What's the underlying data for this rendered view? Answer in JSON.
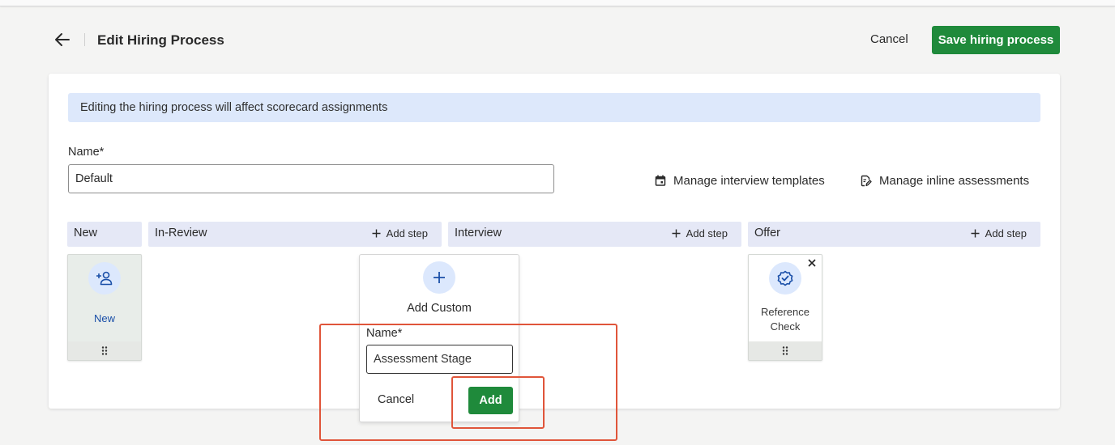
{
  "header": {
    "title": "Edit Hiring Process",
    "cancel_label": "Cancel",
    "save_label": "Save hiring process"
  },
  "banner": {
    "text": "Editing the hiring process will affect scorecard assignments"
  },
  "form": {
    "name_label": "Name*",
    "name_value": "Default"
  },
  "links": {
    "templates": "Manage interview templates",
    "assessments": "Manage inline assessments"
  },
  "columns": [
    {
      "label": "New"
    },
    {
      "label": "In-Review",
      "add_step": "Add step"
    },
    {
      "label": "Interview",
      "add_step": "Add step"
    },
    {
      "label": "Offer",
      "add_step": "Add step"
    }
  ],
  "stages": {
    "new": {
      "label": "New",
      "icon": "add-person-icon"
    },
    "reference": {
      "label_line1": "Reference",
      "label_line2": "Check",
      "icon": "verified-badge-icon"
    }
  },
  "popover": {
    "title": "Add Custom",
    "name_label": "Name*",
    "name_value": "Assessment Stage",
    "cancel_label": "Cancel",
    "add_label": "Add"
  },
  "colors": {
    "primary": "#1f8a3b",
    "banner_bg": "#dde8fb",
    "column_header_bg": "#e5e8f6",
    "icon_circle_bg": "#dce8fd",
    "icon_blue": "#1a4fa8",
    "highlight": "#e0553a"
  }
}
